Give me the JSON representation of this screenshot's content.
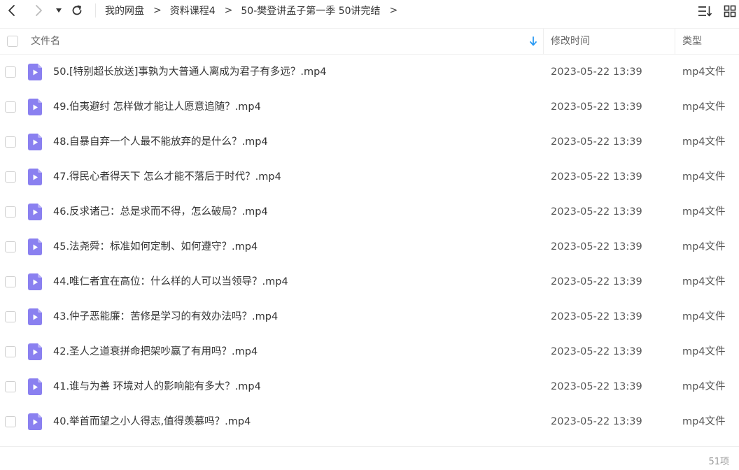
{
  "toolbar": {
    "back_icon": "chevron-left-icon",
    "forward_icon": "chevron-right-icon",
    "history_icon": "caret-down-icon",
    "refresh_icon": "refresh-icon",
    "sort_icon": "sort-list-icon",
    "grid_icon": "grid-view-icon"
  },
  "breadcrumb": {
    "items": [
      "我的网盘",
      "资料课程4",
      "50-樊登讲孟子第一季 50讲完结"
    ],
    "separator": ">"
  },
  "columns": {
    "name": "文件名",
    "time": "修改时间",
    "type": "类型"
  },
  "files": [
    {
      "name": "50.[特别超长放送]事孰为大普通人离成为君子有多远？.mp4",
      "time": "2023-05-22 13:39",
      "type": "mp4文件"
    },
    {
      "name": "49.伯夷避纣 怎样做才能让人愿意追随？.mp4",
      "time": "2023-05-22 13:39",
      "type": "mp4文件"
    },
    {
      "name": "48.自暴自弃一个人最不能放弃的是什么？.mp4",
      "time": "2023-05-22 13:39",
      "type": "mp4文件"
    },
    {
      "name": "47.得民心者得天下 怎么才能不落后于时代？.mp4",
      "time": "2023-05-22 13:39",
      "type": "mp4文件"
    },
    {
      "name": "46.反求诸己：总是求而不得，怎么破局？.mp4",
      "time": "2023-05-22 13:39",
      "type": "mp4文件"
    },
    {
      "name": "45.法尧舜：标准如何定制、如何遵守？.mp4",
      "time": "2023-05-22 13:39",
      "type": "mp4文件"
    },
    {
      "name": "44.唯仁者宜在高位：什么样的人可以当领导？.mp4",
      "time": "2023-05-22 13:39",
      "type": "mp4文件"
    },
    {
      "name": "43.仲子恶能廉：苦修是学习的有效办法吗？.mp4",
      "time": "2023-05-22 13:39",
      "type": "mp4文件"
    },
    {
      "name": "42.圣人之道衰拼命把架吵赢了有用吗？.mp4",
      "time": "2023-05-22 13:39",
      "type": "mp4文件"
    },
    {
      "name": "41.谁与为善 环境对人的影响能有多大？.mp4",
      "time": "2023-05-22 13:39",
      "type": "mp4文件"
    },
    {
      "name": "40.举首而望之小人得志,值得羡慕吗？.mp4",
      "time": "2023-05-22 13:39",
      "type": "mp4文件"
    }
  ],
  "file_icon": "video-file-icon",
  "footer": {
    "count": "51项"
  },
  "colors": {
    "accent": "#2b9af3",
    "icon": "#8a80f0"
  }
}
